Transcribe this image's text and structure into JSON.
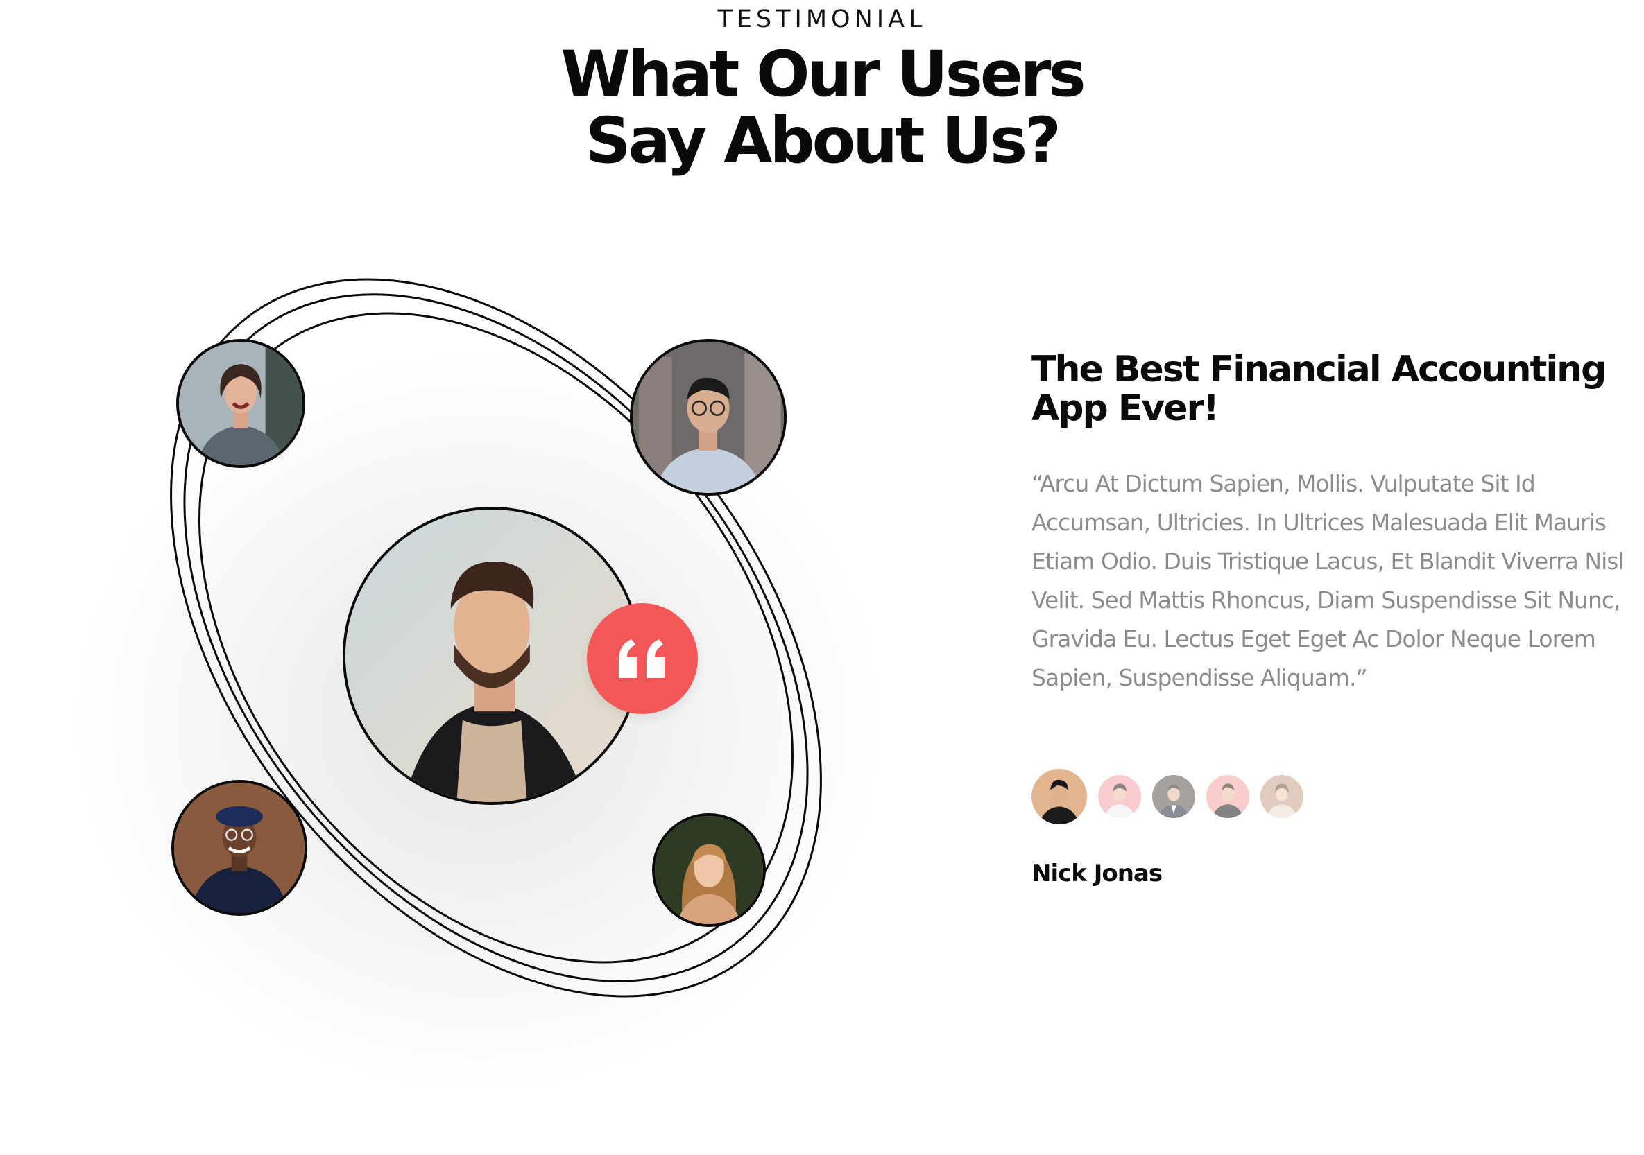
{
  "header": {
    "eyebrow": "TESTIMONIAL",
    "title_line1": "What Our Users",
    "title_line2": "Say About Us?"
  },
  "testimonial": {
    "title_line1": "The Best Financial Accounting",
    "title_line2": "App Ever!",
    "quote": "“Arcu At Dictum Sapien, Mollis. Vulputate Sit Id Accumsan, Ultricies. In Ultrices Malesuada Elit Mauris Etiam Odio. Duis Tristique Lacus, Et Blandit Viverra Nisl Velit. Sed Mattis Rhoncus, Diam Suspendisse Sit Nunc, Gravida Eu. Lectus Eget Eget Ac Dolor Neque Lorem Sapien, Suspendisse Aliquam.”",
    "author": "Nick Jonas"
  },
  "graphic": {
    "center_avatar": "bearded-man-portrait",
    "orbit_avatars": [
      "laughing-woman-portrait",
      "man-with-glasses-portrait",
      "man-in-beret-portrait",
      "blonde-woman-portrait"
    ],
    "quote_icon": "quote-icon"
  },
  "reviewer_thumbs": [
    {
      "name": "reviewer-thumb-1",
      "state": "active"
    },
    {
      "name": "reviewer-thumb-2",
      "state": "inactive"
    },
    {
      "name": "reviewer-thumb-3",
      "state": "inactive"
    },
    {
      "name": "reviewer-thumb-4",
      "state": "inactive"
    },
    {
      "name": "reviewer-thumb-5",
      "state": "inactive"
    }
  ],
  "colors": {
    "accent": "#f45757",
    "text_dark": "#0a0a0a",
    "text_muted": "#8c8c8c",
    "background": "#ffffff"
  }
}
